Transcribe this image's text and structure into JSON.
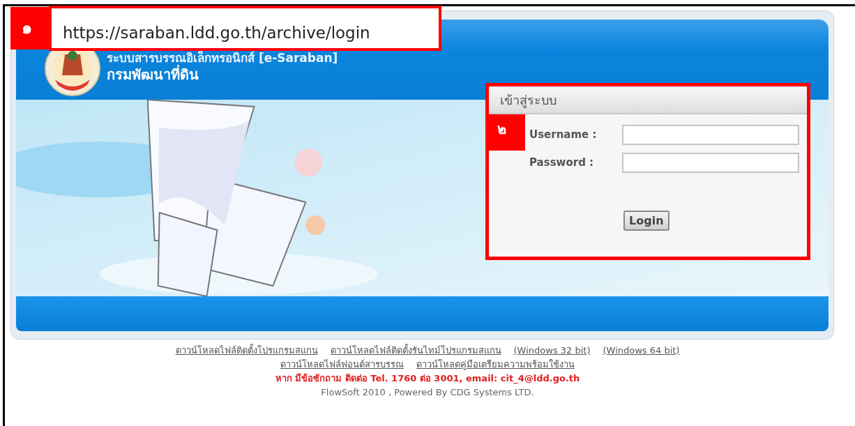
{
  "url_callout": {
    "badge": "๑",
    "url": "https://saraban.ldd.go.th/archive/login"
  },
  "header": {
    "title": "ระบบสารบรรณอิเล็กทรอนิกส์ [e-Saraban]",
    "subtitle": "กรมพัฒนาที่ดิน"
  },
  "login": {
    "badge": "๒",
    "title": "เข้าสู่ระบบ",
    "fields": [
      {
        "label": "Username :"
      },
      {
        "label": "Password :"
      }
    ],
    "button": "Login"
  },
  "footer": {
    "link_rows": [
      [
        "ดาวน์โหลดไฟล์ติดตั้งโปรแกรมสแกน",
        "ดาวน์โหลดไฟล์ติดตั้งรันไทม์โปรแกรมสแกน",
        "(Windows 32 bit)",
        "(Windows 64 bit)"
      ],
      [
        "ดาวน์โหลดไฟล์ฟอนต์สารบรรณ",
        "ดาวน์โหลดคู่มือเตรียมความพร้อมใช้งาน"
      ]
    ],
    "contact": "หาก มีข้อซักถาม ติดต่อ Tel. 1760 ต่อ 3001, email: cit_4@ldd.go.th",
    "credit": "FlowSoft 2010 , Powered By CDG Systems LTD."
  }
}
